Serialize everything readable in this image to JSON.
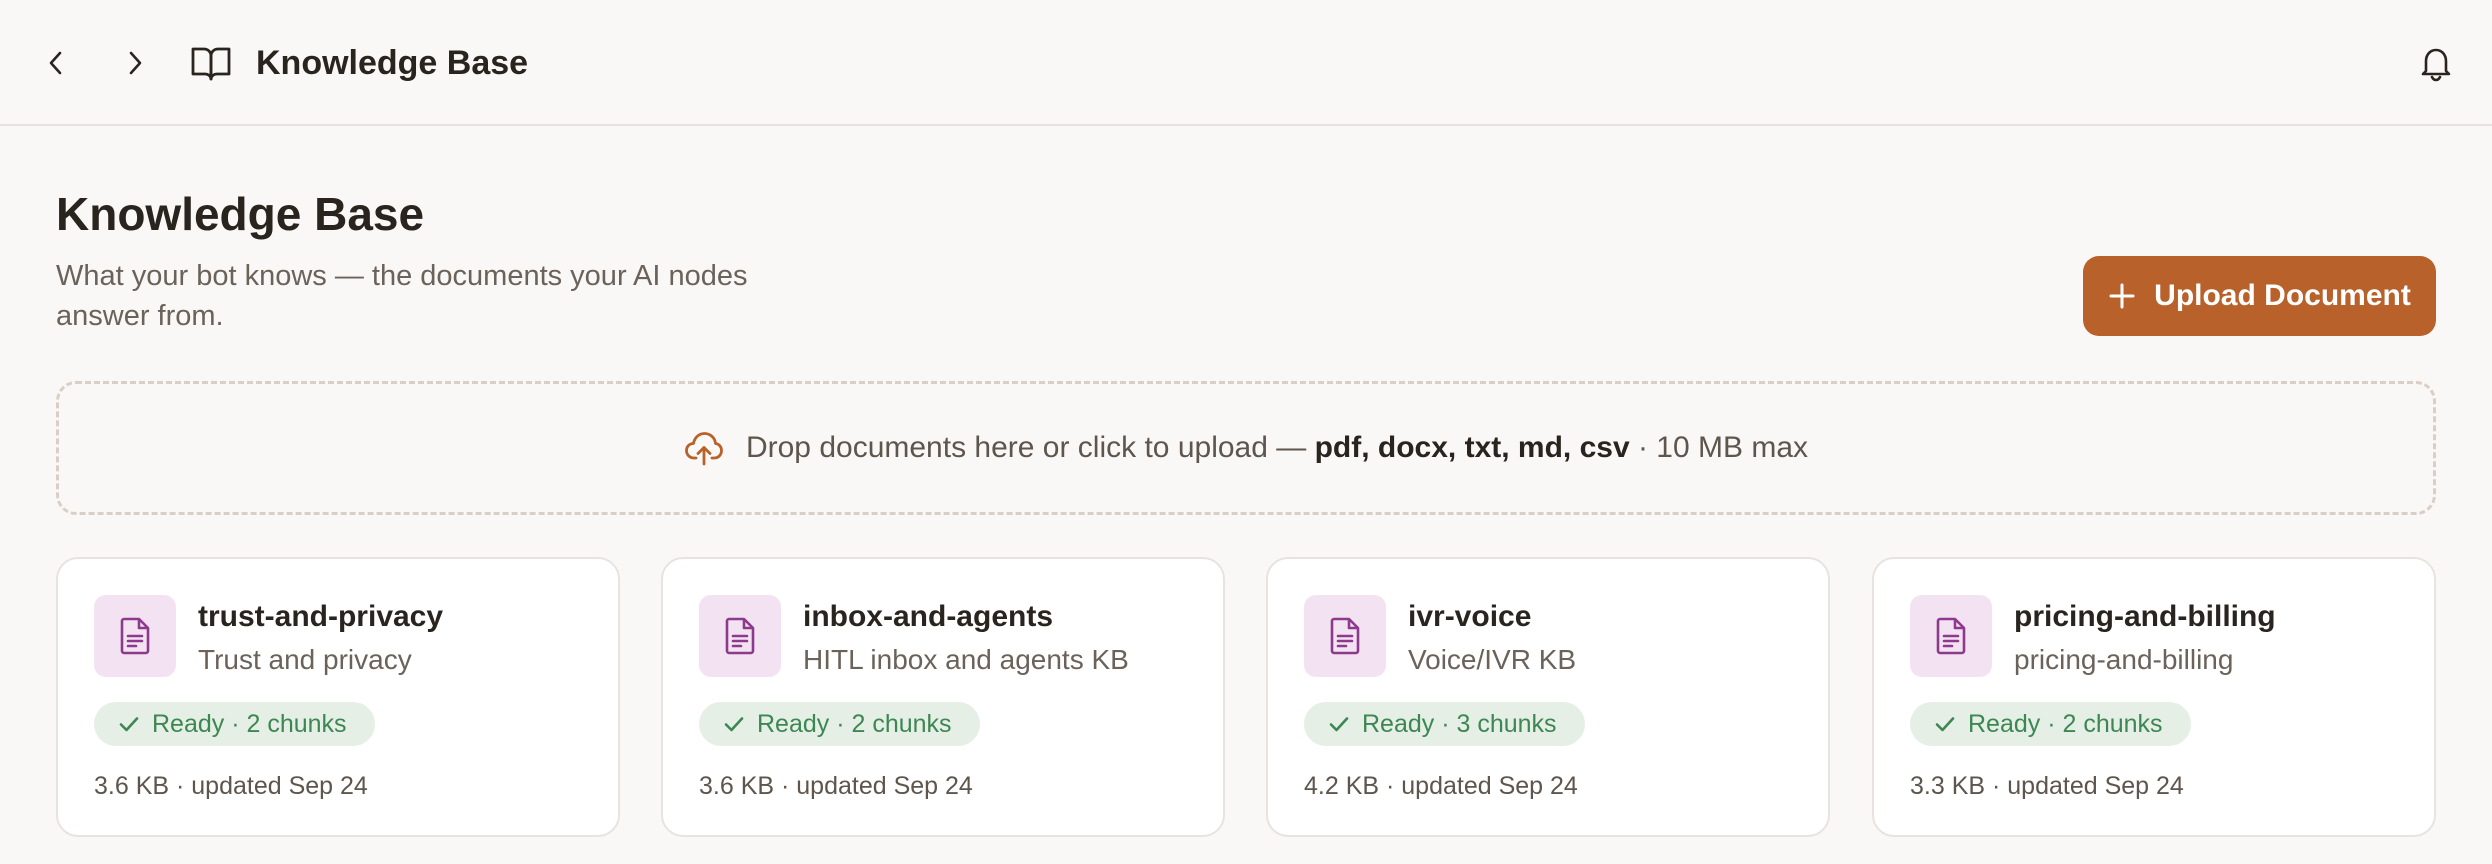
{
  "topbar": {
    "title": "Knowledge Base",
    "icons": {
      "back": "chevron-left-icon",
      "forward": "chevron-right-icon",
      "book": "book-open-icon",
      "bell": "bell-icon"
    }
  },
  "header": {
    "title": "Knowledge Base",
    "subtitle": "What your bot knows — the documents your AI nodes answer from.",
    "upload_label": "Upload Document"
  },
  "dropzone": {
    "prefix": "Drop documents here or click to upload — ",
    "types": "pdf, docx, txt, md, csv",
    "suffix": " · 10 MB max",
    "icon": "cloud-upload-icon"
  },
  "documents": [
    {
      "name": "trust-and-privacy",
      "description": "Trust and privacy",
      "status": "Ready · 2 chunks",
      "meta": "3.6 KB · updated Sep 24"
    },
    {
      "name": "inbox-and-agents",
      "description": "HITL inbox and agents KB",
      "status": "Ready · 2 chunks",
      "meta": "3.6 KB · updated Sep 24"
    },
    {
      "name": "ivr-voice",
      "description": "Voice/IVR KB",
      "status": "Ready · 3 chunks",
      "meta": "4.2 KB · updated Sep 24"
    },
    {
      "name": "pricing-and-billing",
      "description": "pricing-and-billing",
      "status": "Ready · 2 chunks",
      "meta": "3.3 KB · updated Sep 24"
    }
  ],
  "colors": {
    "accent": "#b8612a",
    "doc_icon_bg": "#f3e3f2",
    "doc_icon": "#8e3a8c",
    "status_bg": "#e5efe6",
    "status_text": "#3d8753",
    "background": "#faf8f6"
  }
}
